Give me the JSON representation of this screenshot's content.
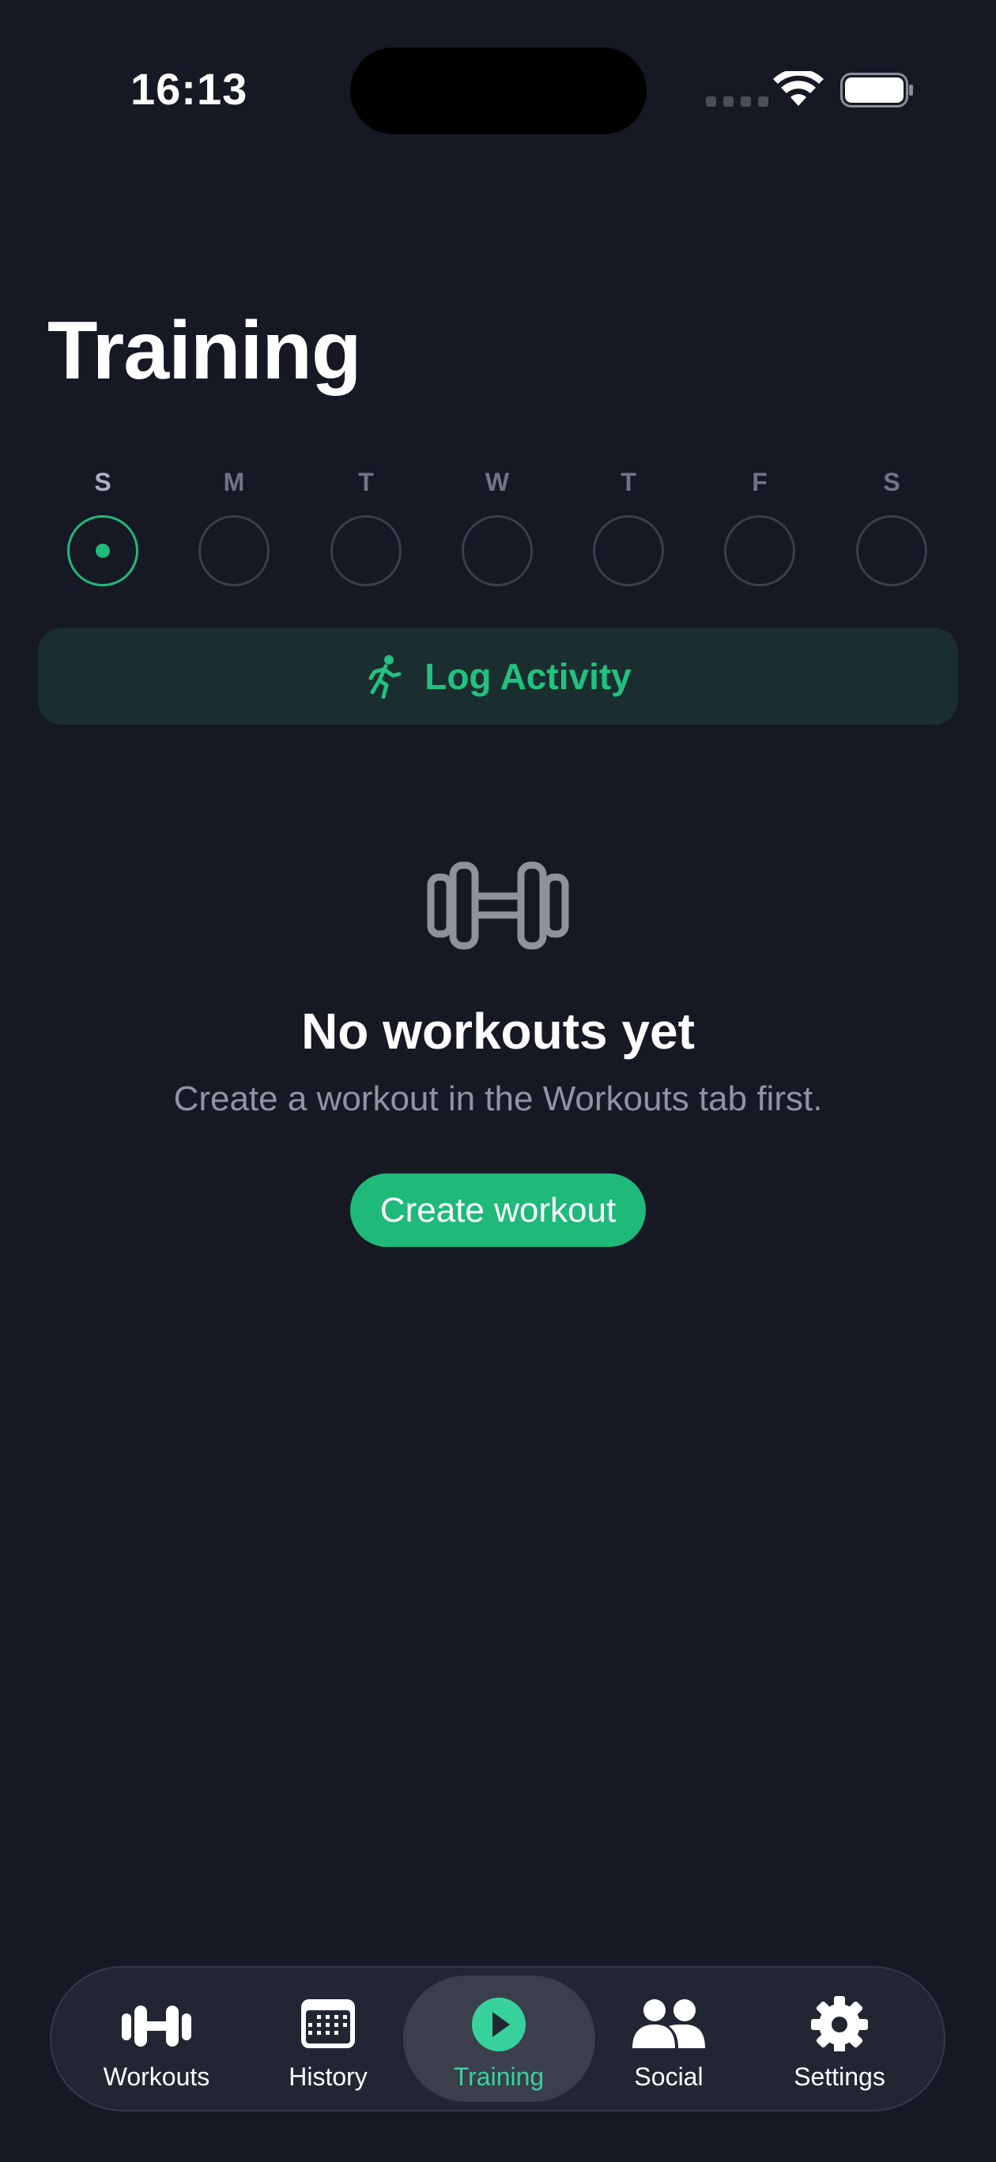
{
  "status_bar": {
    "time": "16:13"
  },
  "page": {
    "title": "Training"
  },
  "week": {
    "days": [
      {
        "letter": "S",
        "today": true
      },
      {
        "letter": "M",
        "today": false
      },
      {
        "letter": "T",
        "today": false
      },
      {
        "letter": "W",
        "today": false
      },
      {
        "letter": "T",
        "today": false
      },
      {
        "letter": "F",
        "today": false
      },
      {
        "letter": "S",
        "today": false
      }
    ]
  },
  "log_activity": {
    "label": "Log Activity",
    "icon": "runner-icon"
  },
  "empty_state": {
    "icon": "dumbbell-icon",
    "title": "No workouts yet",
    "subtitle": "Create a workout in the Workouts tab first.",
    "button_label": "Create workout"
  },
  "tab_bar": {
    "tabs": [
      {
        "label": "Workouts",
        "icon": "dumbbell-icon"
      },
      {
        "label": "History",
        "icon": "calendar-icon"
      },
      {
        "label": "Training",
        "icon": "play-icon",
        "active": true
      },
      {
        "label": "Social",
        "icon": "people-icon"
      },
      {
        "label": "Settings",
        "icon": "gear-icon"
      }
    ]
  },
  "colors": {
    "background": "#161923",
    "accent": "#1fb97a",
    "active_tab_label": "#37d29b",
    "log_activity_bg": "#1a2e2f"
  }
}
